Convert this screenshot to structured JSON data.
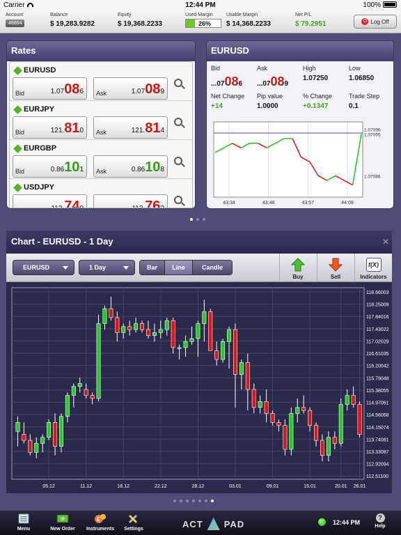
{
  "status": {
    "carrier": "Carrier",
    "time": "12:44 PM",
    "battery": "100%"
  },
  "account": {
    "account_label": "Account",
    "account_no": "46664",
    "balance_label": "Balance",
    "balance": "$ 19,283.9282",
    "equity_label": "Equity",
    "equity": "$ 19,368.2233",
    "used_margin_label": "Used Margin",
    "used_margin": "26%",
    "used_margin_fraction": 0.26,
    "usable_margin_label": "Usable Margin",
    "usable_margin": "$ 14,368.2233",
    "netpl_label": "Net P/L",
    "netpl": "$ 79.2951",
    "logoff": "Log Off"
  },
  "rates": {
    "title": "Rates",
    "rows": [
      {
        "symbol": "EURUSD",
        "bid_label": "Bid",
        "bid_pre": "1.07",
        "bid_big": "08",
        "bid_post": "6",
        "bid_color": "red",
        "ask_label": "Ask",
        "ask_pre": "1.07",
        "ask_big": "08",
        "ask_post": "9",
        "ask_color": "red"
      },
      {
        "symbol": "EURJPY",
        "bid_label": "Bid",
        "bid_pre": "121.",
        "bid_big": "81",
        "bid_post": "0",
        "bid_color": "red",
        "ask_label": "Ask",
        "ask_pre": "121.",
        "ask_big": "81",
        "ask_post": "4",
        "ask_color": "red"
      },
      {
        "symbol": "EURGBP",
        "bid_label": "Bid",
        "bid_pre": "0.86",
        "bid_big": "10",
        "bid_post": "1",
        "bid_color": "green",
        "ask_label": "Ask",
        "ask_pre": "0.86",
        "ask_big": "10",
        "ask_post": "8",
        "ask_color": "green"
      },
      {
        "symbol": "USDJPY",
        "bid_label": "Bid",
        "bid_pre": "113.",
        "bid_big": "74",
        "bid_post": "0",
        "bid_color": "red",
        "ask_label": "Ask",
        "ask_pre": "113.",
        "ask_big": "76",
        "ask_post": "2",
        "ask_color": "red"
      }
    ]
  },
  "detail": {
    "title": "EURUSD",
    "bid_label": "Bid",
    "bid_pre": "...07",
    "bid_big": "08",
    "bid_post": "6",
    "ask_label": "Ask",
    "ask_pre": "...07",
    "ask_big": "08",
    "ask_post": "9",
    "high_label": "High",
    "high": "1.07250",
    "low_label": "Low",
    "low": "1.06850",
    "net_change_label": "Net Change",
    "net_change": "+14",
    "pip_label": "Pip value",
    "pip": "1.0000",
    "pct_label": "% Change",
    "pct": "+0.1347",
    "step_label": "Trade Step",
    "step": "0.1",
    "mini_chart": {
      "x_ticks": [
        "43:34",
        "43:48",
        "43:57",
        "44:09"
      ],
      "y_ticks": [
        "1.07096",
        "1.07095",
        "1.07086"
      ],
      "series": [
        1.07091,
        1.07092,
        1.07093,
        1.07092,
        1.07093,
        1.07093,
        1.07092,
        1.07093,
        1.07094,
        1.07094,
        1.0709,
        1.07089,
        1.07086,
        1.07085,
        1.07086,
        1.07085,
        1.07084,
        1.07095
      ]
    }
  },
  "chart_panel": {
    "title": "Chart - EURUSD - 1 Day",
    "instrument": "EURUSD",
    "period": "1 Day",
    "types": [
      "Bar",
      "Line",
      "Candle"
    ],
    "selected_type": "Line",
    "buy": "Buy",
    "sell": "Sell",
    "indicators": "Indicators",
    "indicators_icon": "f(X)"
  },
  "chart_data": {
    "type": "candlestick",
    "x_ticks": [
      "05.12",
      "11.12",
      "16.12",
      "22.12",
      "28.12",
      "03.01",
      "09.01",
      "15.01",
      "20.01",
      "26.01"
    ],
    "y_ticks": [
      "118.66003",
      "118.25009",
      "117.84016",
      "117.43022",
      "117.02029",
      "116.61035",
      "116.20042",
      "115.79048",
      "115.38055",
      "114.97061",
      "114.56068",
      "114.15074",
      "113.74081",
      "113.33087",
      "112.92094",
      "112.51100"
    ],
    "ylim": [
      112.4,
      118.8
    ],
    "candles": [
      [
        114,
        114.5,
        113.5,
        114.3
      ],
      [
        113.9,
        114.3,
        113.6,
        113.7
      ],
      [
        113.7,
        113.9,
        113.2,
        113.3
      ],
      [
        113.3,
        113.8,
        113.1,
        113.6
      ],
      [
        113.6,
        113.9,
        113.3,
        113.8
      ],
      [
        113.8,
        114.4,
        113.7,
        114.3
      ],
      [
        114.3,
        114.6,
        113.2,
        113.5
      ],
      [
        113.5,
        114.6,
        113.3,
        114.5
      ],
      [
        114.5,
        115.3,
        114.3,
        115.2
      ],
      [
        115.2,
        115.6,
        114.8,
        115.5
      ],
      [
        115.5,
        115.8,
        115.3,
        115.6
      ],
      [
        115.4,
        115.6,
        115.1,
        115.2
      ],
      [
        115.2,
        115.3,
        114.9,
        115.1
      ],
      [
        115.1,
        117.9,
        115.0,
        117.6
      ],
      [
        117.6,
        118.2,
        117.4,
        118.1
      ],
      [
        118.1,
        118.5,
        117.7,
        117.8
      ],
      [
        117.8,
        118.0,
        117.0,
        117.3
      ],
      [
        117.3,
        117.6,
        117.1,
        117.5
      ],
      [
        117.5,
        117.7,
        117.2,
        117.4
      ],
      [
        117.4,
        117.8,
        117.3,
        117.6
      ],
      [
        117.6,
        117.7,
        117.3,
        117.4
      ],
      [
        117.4,
        117.7,
        117.1,
        117.2
      ],
      [
        117.2,
        117.6,
        117.0,
        117.3
      ],
      [
        117.3,
        117.7,
        117.1,
        117.4
      ],
      [
        117.4,
        117.8,
        117.2,
        117.7
      ],
      [
        117.7,
        117.8,
        116.6,
        116.8
      ],
      [
        116.8,
        116.9,
        116.4,
        116.8
      ],
      [
        116.8,
        117.2,
        116.5,
        117.0
      ],
      [
        117.0,
        117.5,
        116.9,
        117.1
      ],
      [
        117.1,
        117.7,
        116.5,
        117.6
      ],
      [
        117.6,
        118.4,
        117.0,
        118.0
      ],
      [
        118.0,
        118.1,
        116.7,
        116.7
      ],
      [
        116.7,
        117.0,
        116.2,
        116.4
      ],
      [
        116.4,
        117.1,
        116.3,
        117.0
      ],
      [
        117.0,
        117.5,
        116.1,
        117.4
      ],
      [
        117.4,
        117.6,
        114.8,
        115.9
      ],
      [
        115.9,
        116.4,
        115.4,
        116.3
      ],
      [
        116.3,
        116.6,
        114.7,
        115.4
      ],
      [
        115.4,
        115.6,
        114.6,
        114.8
      ],
      [
        114.8,
        115.2,
        114.6,
        115.0
      ],
      [
        115.0,
        115.4,
        114.3,
        114.6
      ],
      [
        114.6,
        114.7,
        114.2,
        114.3
      ],
      [
        114.3,
        114.4,
        114.0,
        114.2
      ],
      [
        114.2,
        114.4,
        113.2,
        113.4
      ],
      [
        113.4,
        114.8,
        113.2,
        114.6
      ],
      [
        114.6,
        115.1,
        114.3,
        114.8
      ],
      [
        114.8,
        115.2,
        114.6,
        114.7
      ],
      [
        114.7,
        114.8,
        114.0,
        114.2
      ],
      [
        114.2,
        114.3,
        113.5,
        113.7
      ],
      [
        113.7,
        113.9,
        113.0,
        113.2
      ],
      [
        113.2,
        114.0,
        113.0,
        113.8
      ],
      [
        113.8,
        114.0,
        113.4,
        113.6
      ],
      [
        113.6,
        115.1,
        113.5,
        114.9
      ],
      [
        114.9,
        115.4,
        114.7,
        115.2
      ],
      [
        115.2,
        115.5,
        114.8,
        114.9
      ],
      [
        114.9,
        115.0,
        113.8,
        113.9
      ]
    ]
  },
  "pager_top": {
    "count": 3,
    "active": 0
  },
  "pager_bottom": {
    "count": 7,
    "active": 6
  },
  "tabs": [
    {
      "label": "Menu",
      "icon": "menu-icon"
    },
    {
      "label": "New Order",
      "icon": "new-order-icon"
    },
    {
      "label": "Instruments",
      "icon": "instruments-icon"
    },
    {
      "label": "Settings",
      "icon": "settings-icon"
    }
  ],
  "brand": {
    "left": "ACT",
    "right": "PAD"
  },
  "footer": {
    "time": "12:44 PM",
    "help": "Help"
  },
  "colors": {
    "up": "#22cc22",
    "down": "#e01616",
    "panel_header": "#403c6c",
    "bg": "#504c78"
  }
}
